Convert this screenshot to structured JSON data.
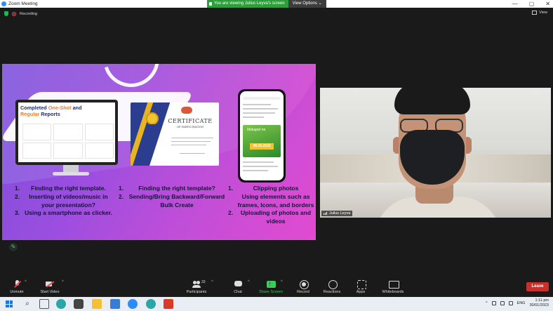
{
  "window": {
    "title": "Zoom Meeting",
    "controls": [
      "—",
      "▢",
      "✕"
    ]
  },
  "share_banner": {
    "message": "You are viewing Julius Leyva's screen",
    "options_label": "View Options"
  },
  "status": {
    "recording_label": "Recording",
    "view_label": "View"
  },
  "slide": {
    "monitor": {
      "title_part1": "Completed ",
      "title_highlight1": "One-Shot",
      "title_part2": " and",
      "title_highlight2": "Regular",
      "title_part3": " Reports"
    },
    "certificate": {
      "title": "CERTIFICATE",
      "subtitle": "OF PARTICIPATION"
    },
    "phone": {
      "post_title": "Malugod na",
      "post_date": "08.16.2022"
    },
    "column1": [
      {
        "num": "1.",
        "text": "Finding the right template."
      },
      {
        "num": "2.",
        "text": "Inserting of videos/music in your presentation?"
      },
      {
        "num": "3.",
        "text": "Using a smartphone as clicker."
      }
    ],
    "column2": [
      {
        "num": "1.",
        "text": "Finding the right template?"
      },
      {
        "num": "2.",
        "text": "Sending/Bring Backward/Forward Bulk Create"
      }
    ],
    "column3": [
      {
        "num": "1.",
        "text": "Clipping photos"
      },
      {
        "num": "",
        "text": "Using elements such as frames, Icons, and borders"
      },
      {
        "num": "2.",
        "text": "Uploading of photos and videos"
      }
    ]
  },
  "video": {
    "participant_name": "Julius Leyva"
  },
  "toolbar": {
    "unmute": "Unmute",
    "start_video": "Start Video",
    "participants": "Participants",
    "participants_count": "33",
    "chat": "Chat",
    "share_screen": "Share Screen",
    "record": "Record",
    "reactions": "Reactions",
    "apps": "Apps",
    "whiteboards": "Whiteboards",
    "leave": "Leave"
  },
  "taskbar": {
    "language": "ENG",
    "time": "1:11 pm",
    "date": "30/01/2023"
  },
  "colors": {
    "share_green": "#2e9e3b",
    "leave_red": "#c9302c",
    "accent_orange": "#f47a20"
  }
}
